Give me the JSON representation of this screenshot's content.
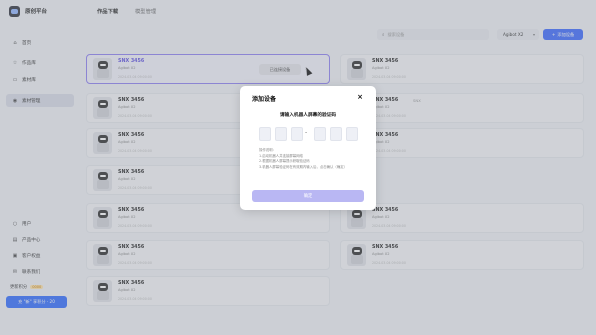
{
  "app": {
    "brand": "原创平台"
  },
  "nav": {
    "tabs": [
      {
        "label": "作品下载"
      },
      {
        "label": "模型管理"
      }
    ]
  },
  "sidebar": {
    "items": [
      {
        "label": "首页",
        "icon": "home-icon"
      },
      {
        "label": "作品库",
        "icon": "works-icon"
      },
      {
        "label": "素材库",
        "icon": "assets-icon"
      },
      {
        "label": "素材管理",
        "icon": "manage-icon"
      }
    ],
    "bottom_items": [
      {
        "label": "用户",
        "icon": "user-icon"
      },
      {
        "label": "产品中心",
        "icon": "product-icon"
      },
      {
        "label": "客户权益",
        "icon": "benefit-icon"
      },
      {
        "label": "联系我们",
        "icon": "contact-icon"
      }
    ],
    "user": {
      "label": "更新积分",
      "badge": "0000"
    },
    "upgrade_label": "充 \"新\" 享积分 · 20"
  },
  "toolbar": {
    "search_placeholder": "搜索设备",
    "select_value": "Agibot X2",
    "add_label": "添加设备"
  },
  "cards": [
    {
      "name": "SNX 3456",
      "sub": "Agibot X2",
      "date": "2024-03-04 09:00:00"
    },
    {
      "name": "SNX 3456",
      "sub": "Agibot X2",
      "date": "2024-03-04 09:00:00"
    },
    {
      "name": "SNX 3456",
      "sub": "Agibot X2",
      "date": "2024-03-04 09:00:00"
    },
    {
      "name": "SNX 3456",
      "sub": "Agibot X2",
      "date": "2024-03-04 09:00:00"
    },
    {
      "name": "SNX 3456",
      "sub": "Agibot X2",
      "date": "2024-03-04 09:00:00"
    },
    {
      "name": "SNX 3456",
      "sub": "Agibot X2",
      "date": "2024-03-04 09:00:00"
    },
    {
      "name": "SNX 3456",
      "sub": "Agibot X2",
      "date": "2024-03-04 09:00:00"
    },
    {
      "name": "SNX 3456",
      "sub": "Agibot X2",
      "date": "2024-03-04 09:00:00"
    },
    {
      "name": "SNX 3456",
      "sub": "Agibot X2",
      "date": "2024-03-04 09:00:00"
    },
    {
      "name": "SNX 3456",
      "sub": "Agibot X2",
      "date": "2024-03-04 09:00:00"
    },
    {
      "name": "SNX 3456",
      "sub": "Agibot X2",
      "date": "2024-03-04 09:00:00"
    },
    {
      "name": "SNX 3456",
      "sub": "Agibot X2",
      "date": "2024-03-04 09:00:00"
    }
  ],
  "selected_card": {
    "bound_label": "已连接设备",
    "arrow": "›"
  },
  "card_tag": "SNX",
  "modal": {
    "title": "添加设备",
    "close": "×",
    "subtitle": "请输入机器人屏幕的验证码",
    "dash": "-",
    "help": [
      "操作说明：",
      "1.启动机器人并连接屏幕网络",
      "2.根据机器人屏幕提示获取验证码",
      "3.机器人屏幕验证码在有效期内输入后，点击确认（确定）"
    ],
    "confirm": "确定"
  },
  "colors": {
    "accent": "#3a68ff",
    "selected_border": "#8d7ff2",
    "confirm_disabled": "#b9b7f3"
  }
}
